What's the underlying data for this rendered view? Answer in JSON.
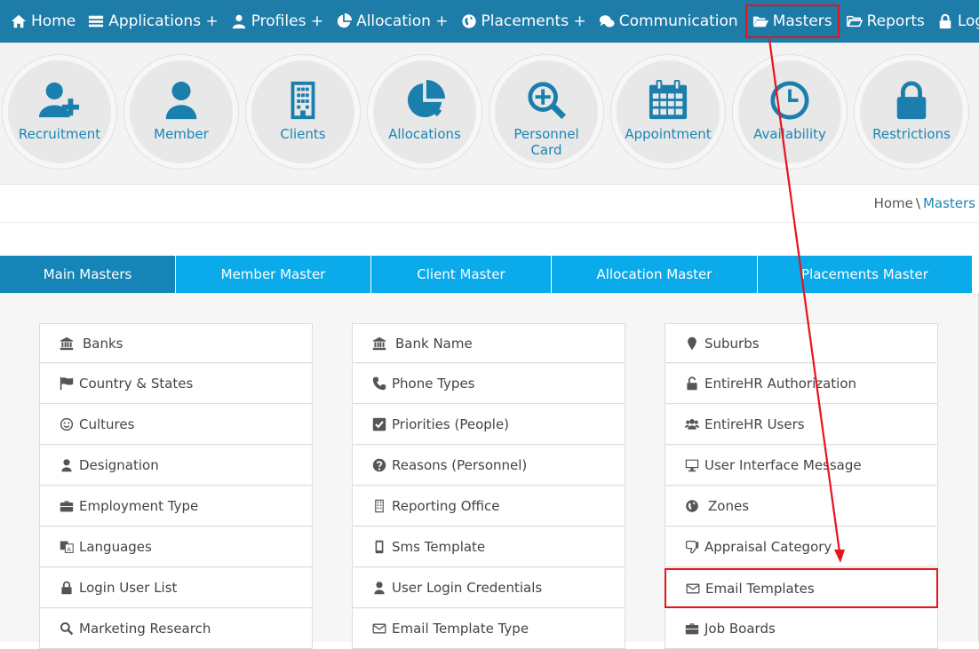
{
  "nav": [
    {
      "label": "Home",
      "icon": "home-icon"
    },
    {
      "label": "Applications +",
      "icon": "list-icon"
    },
    {
      "label": "Profiles +",
      "icon": "user-icon"
    },
    {
      "label": "Allocation +",
      "icon": "pie-chart-icon"
    },
    {
      "label": "Placements +",
      "icon": "globe-icon"
    },
    {
      "label": "Communication",
      "icon": "chat-icon"
    },
    {
      "label": "Masters",
      "icon": "folder-open-icon"
    },
    {
      "label": "Reports",
      "icon": "folder-icon"
    },
    {
      "label": "Logins +",
      "icon": "lock-icon"
    }
  ],
  "quick": [
    {
      "label": "Recruitment"
    },
    {
      "label": "Member"
    },
    {
      "label": "Clients"
    },
    {
      "label": "Allocations"
    },
    {
      "label": "Personnel Card"
    },
    {
      "label": "Appointment"
    },
    {
      "label": "Availability"
    },
    {
      "label": "Restrictions"
    }
  ],
  "breadcrumb": {
    "home": "Home",
    "sep": "\\",
    "current": "Masters"
  },
  "tabs": [
    {
      "label": "Main Masters"
    },
    {
      "label": "Member Master"
    },
    {
      "label": "Client Master"
    },
    {
      "label": "Allocation Master"
    },
    {
      "label": "Placements Master"
    }
  ],
  "columns": [
    [
      {
        "label": "Banks",
        "icon": "bank-icon"
      },
      {
        "label": "Country & States",
        "icon": "flag-icon"
      },
      {
        "label": "Cultures",
        "icon": "smile-icon"
      },
      {
        "label": "Designation",
        "icon": "user-icon"
      },
      {
        "label": "Employment Type",
        "icon": "briefcase-icon"
      },
      {
        "label": "Languages",
        "icon": "language-icon"
      },
      {
        "label": "Login User List",
        "icon": "lock-icon"
      },
      {
        "label": "Marketing Research",
        "icon": "search-icon"
      }
    ],
    [
      {
        "label": "Bank Name",
        "icon": "bank-icon"
      },
      {
        "label": "Phone Types",
        "icon": "phone-icon"
      },
      {
        "label": "Priorities (People)",
        "icon": "checkbox-icon"
      },
      {
        "label": "Reasons (Personnel)",
        "icon": "question-icon"
      },
      {
        "label": "Reporting Office",
        "icon": "building-icon"
      },
      {
        "label": "Sms Template",
        "icon": "mobile-icon"
      },
      {
        "label": "User Login Credentials",
        "icon": "user-icon"
      },
      {
        "label": "Email Template Type",
        "icon": "envelope-icon"
      }
    ],
    [
      {
        "label": "Suburbs",
        "icon": "map-marker-icon"
      },
      {
        "label": "EntireHR Authorization",
        "icon": "unlock-icon"
      },
      {
        "label": "EntireHR Users",
        "icon": "users-icon"
      },
      {
        "label": "User Interface Message",
        "icon": "monitor-icon"
      },
      {
        "label": "Zones",
        "icon": "globe-icon"
      },
      {
        "label": "Appraisal Category",
        "icon": "thumbs-down-icon"
      },
      {
        "label": "Email Templates",
        "icon": "envelope-icon"
      },
      {
        "label": "Job Boards",
        "icon": "briefcase-icon"
      }
    ]
  ],
  "colors": {
    "nav": "#1d7ca8",
    "accent": "#1a86b6",
    "tab": "#0aaaeb",
    "tab_active": "#1585b7",
    "highlight": "#e8131b"
  }
}
